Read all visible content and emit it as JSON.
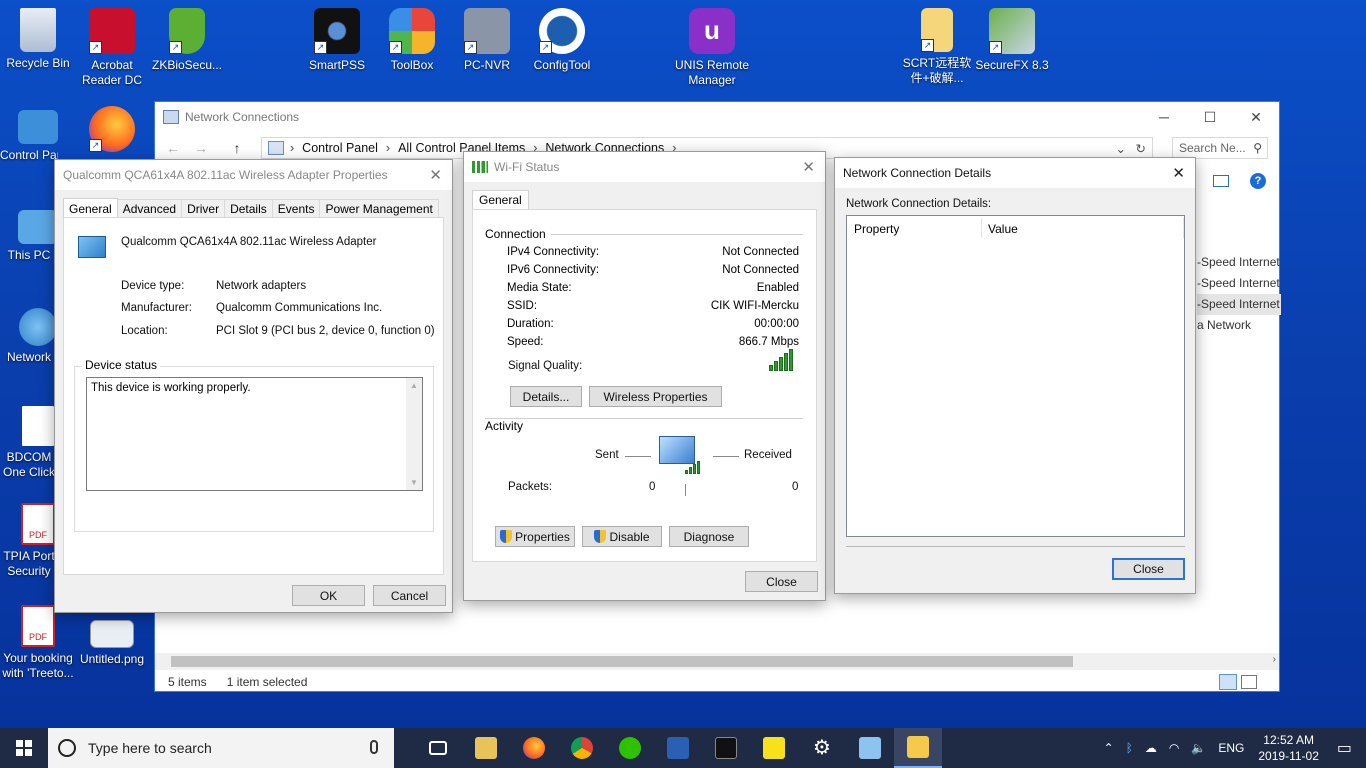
{
  "desktop": {
    "icons_left": [
      {
        "label": "Recycle Bin"
      },
      {
        "label": "Control Panel"
      },
      {
        "label": "This PC"
      },
      {
        "label": "Network"
      },
      {
        "label": "BDCOM One Click Auth"
      },
      {
        "label": "TPIA Port Security"
      },
      {
        "label": "Your booking with 'Treeto..."
      }
    ],
    "icons_top": [
      {
        "label": "Acrobat Reader DC"
      },
      {
        "label": "ZKBioSecu..."
      },
      {
        "label": "SmartPSS"
      },
      {
        "label": "ToolBox"
      },
      {
        "label": "PC-NVR"
      },
      {
        "label": "ConfigTool"
      },
      {
        "label": "UNIS Remote Manager"
      },
      {
        "label": "SCRT远程软件+破解..."
      },
      {
        "label": "SecureFX 8.3"
      }
    ],
    "extra_icons": [
      {
        "label": "Untitled.png"
      }
    ]
  },
  "explorer": {
    "title": "Network Connections",
    "breadcrumb": [
      "Control Panel",
      "All Control Panel Items",
      "Network Connections"
    ],
    "search_placeholder": "Search Ne...",
    "right_list": [
      "-Speed Internet",
      "-Speed Internet",
      "-Speed Internet",
      "a Network"
    ],
    "status_items": "5 items",
    "status_selected": "1 item selected"
  },
  "adapter_props": {
    "title": "Qualcomm QCA61x4A 802.11ac Wireless Adapter Properties",
    "tabs": [
      "General",
      "Advanced",
      "Driver",
      "Details",
      "Events",
      "Power Management"
    ],
    "device_name": "Qualcomm QCA61x4A 802.11ac Wireless Adapter",
    "fields": [
      {
        "label": "Device type:",
        "value": "Network adapters"
      },
      {
        "label": "Manufacturer:",
        "value": "Qualcomm Communications Inc."
      },
      {
        "label": "Location:",
        "value": "PCI Slot 9 (PCI bus 2, device 0, function 0)"
      }
    ],
    "status_group": "Device status",
    "status_text": "This device is working properly.",
    "ok": "OK",
    "cancel": "Cancel"
  },
  "wifi_status": {
    "title": "Wi-Fi Status",
    "tab": "General",
    "connection_label": "Connection",
    "rows": [
      {
        "label": "IPv4 Connectivity:",
        "value": "Not Connected"
      },
      {
        "label": "IPv6 Connectivity:",
        "value": "Not Connected"
      },
      {
        "label": "Media State:",
        "value": "Enabled"
      },
      {
        "label": "SSID:",
        "value": "CIK WIFI-Mercku"
      },
      {
        "label": "Duration:",
        "value": "00:00:00"
      },
      {
        "label": "Speed:",
        "value": "866.7 Mbps"
      }
    ],
    "signal_label": "Signal Quality:",
    "signal_level": 5,
    "details_btn": "Details...",
    "wireless_props_btn": "Wireless Properties",
    "activity_label": "Activity",
    "sent_label": "Sent",
    "received_label": "Received",
    "packets_label": "Packets:",
    "packets_sent": "0",
    "packets_received": "0",
    "properties_btn": "Properties",
    "disable_btn": "Disable",
    "diagnose_btn": "Diagnose",
    "close_btn": "Close"
  },
  "details": {
    "title": "Network Connection Details",
    "label": "Network Connection Details:",
    "col_property": "Property",
    "col_value": "Value",
    "close_btn": "Close"
  },
  "taskbar": {
    "search_placeholder": "Type here to search",
    "language": "ENG",
    "time": "12:52 AM",
    "date": "2019-11-02"
  }
}
